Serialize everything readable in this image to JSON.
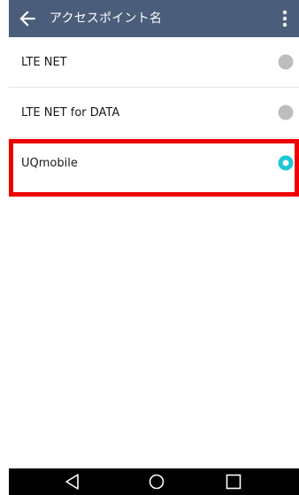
{
  "app_bar": {
    "title": "アクセスポイント名",
    "back_icon": "arrow-back-icon",
    "menu_icon": "more-vert-icon",
    "background": "#4a5d7a"
  },
  "apn_list": [
    {
      "label": "LTE NET",
      "selected": false
    },
    {
      "label": "LTE NET for DATA",
      "selected": false
    },
    {
      "label": "UQmobile",
      "selected": true
    }
  ],
  "colors": {
    "radio_selected": "#1fc7d3",
    "radio_unselected": "#bdbdbd",
    "highlight": "#ee0000"
  },
  "nav_bar": {
    "back_icon": "triangle-back-icon",
    "home_icon": "circle-home-icon",
    "recent_icon": "square-recent-icon"
  }
}
